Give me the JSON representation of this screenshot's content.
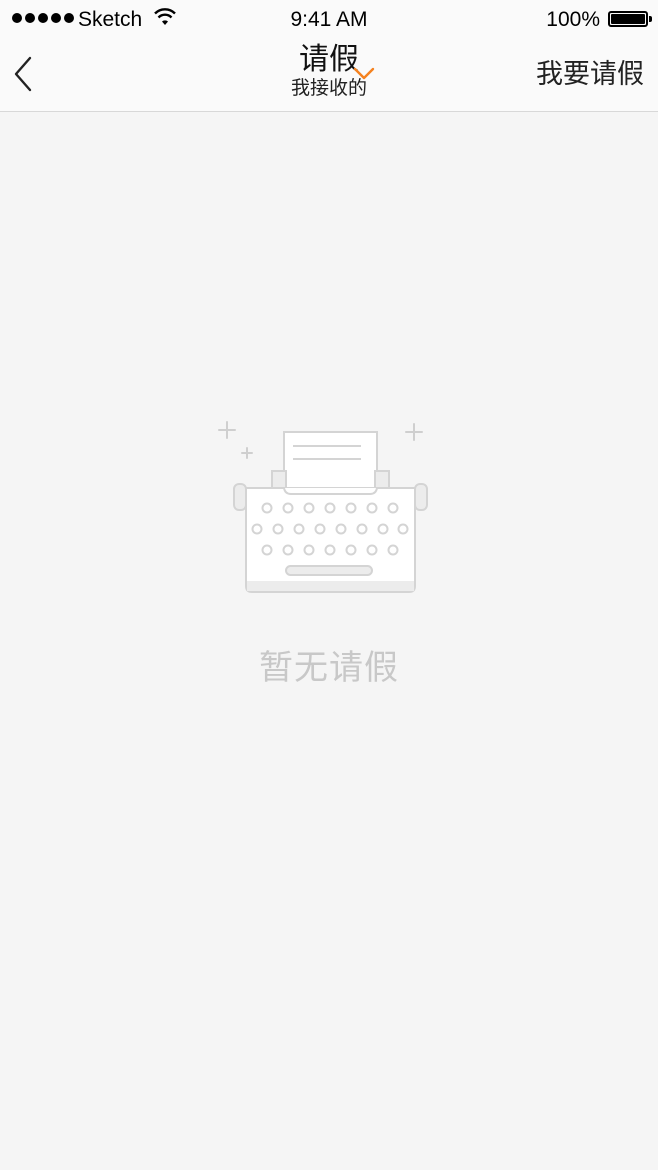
{
  "status_bar": {
    "carrier": "Sketch",
    "time": "9:41 AM",
    "battery": "100%"
  },
  "nav": {
    "back_icon": "chevron-left-icon",
    "title": "请假",
    "subtitle": "我接收的",
    "dropdown_icon": "chevron-down-icon",
    "right_action": "我要请假"
  },
  "empty_state": {
    "icon": "typewriter-icon",
    "text": "暂无请假"
  },
  "colors": {
    "accent": "#f5821f",
    "background": "#f5f5f5",
    "bar_background": "#fafafa",
    "empty_text": "#c8c8c8"
  }
}
